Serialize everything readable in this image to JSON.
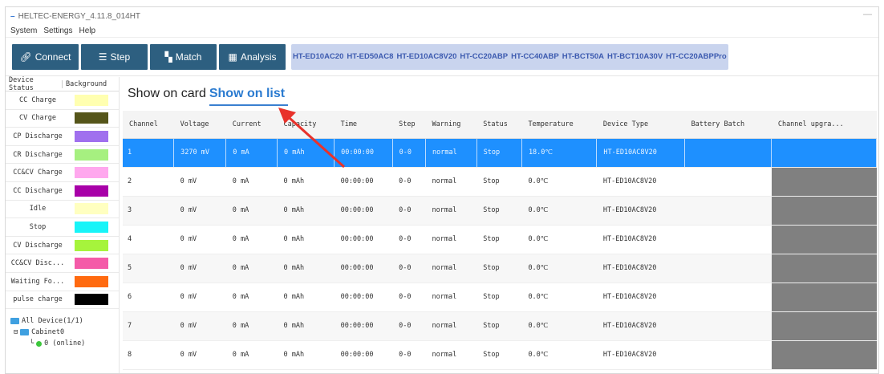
{
  "window": {
    "title": "HELTEC-ENERGY_4.11.8_014HT",
    "minimize": "—"
  },
  "menu": [
    "System",
    "Settings",
    "Help"
  ],
  "toolbar": {
    "buttons": [
      {
        "label": "Connect",
        "icon": "link-icon"
      },
      {
        "label": "Step",
        "icon": "list-icon"
      },
      {
        "label": "Match",
        "icon": "match-icon"
      },
      {
        "label": "Analysis",
        "icon": "chart-icon"
      }
    ],
    "device_tabs": [
      "HT-ED10AC20",
      "HT-ED50AC8",
      "HT-ED10AC8V20",
      "HT-CC20ABP",
      "HT-CC40ABP",
      "HT-BCT50A",
      "HT-BCT10A30V",
      "HT-CC20ABPPro"
    ]
  },
  "legend": {
    "header_status": "Device Status",
    "header_bg": "Background",
    "items": [
      {
        "label": "CC Charge",
        "color": "#ffffb0"
      },
      {
        "label": "CV Charge",
        "color": "#55551a"
      },
      {
        "label": "CP Discharge",
        "color": "#a070ee"
      },
      {
        "label": "CR Discharge",
        "color": "#a6f080"
      },
      {
        "label": "CC&CV Charge",
        "color": "#ffa8ee"
      },
      {
        "label": "CC Discharge",
        "color": "#a800a8"
      },
      {
        "label": "Idle",
        "color": "#ffffc0"
      },
      {
        "label": "Stop",
        "color": "#18f4f8"
      },
      {
        "label": "CV Discharge",
        "color": "#a6f43c"
      },
      {
        "label": "CC&CV Disc...",
        "color": "#f45aa8"
      },
      {
        "label": "Waiting Fo...",
        "color": "#ff6a10"
      },
      {
        "label": "pulse charge",
        "color": "#000000"
      }
    ]
  },
  "tree": {
    "root": "All Device(1/1)",
    "cabinet": "Cabinet0",
    "node": "0 (online)"
  },
  "view": {
    "card": "Show on card",
    "list": "Show on list"
  },
  "table": {
    "columns": [
      "Channel",
      "Voltage",
      "Current",
      "Capacity",
      "Time",
      "Step",
      "Warning",
      "Status",
      "Temperature",
      "Device Type",
      "Battery Batch",
      "Channel upgra..."
    ],
    "rows": [
      [
        "1",
        "3270 mV",
        "0 mA",
        "0 mAh",
        "00:00:00",
        "0-0",
        "normal",
        "Stop",
        "18.0℃",
        "HT-ED10AC8V20",
        "",
        ""
      ],
      [
        "2",
        "0 mV",
        "0 mA",
        "0 mAh",
        "00:00:00",
        "0-0",
        "normal",
        "Stop",
        "0.0℃",
        "HT-ED10AC8V20",
        "",
        ""
      ],
      [
        "3",
        "0 mV",
        "0 mA",
        "0 mAh",
        "00:00:00",
        "0-0",
        "normal",
        "Stop",
        "0.0℃",
        "HT-ED10AC8V20",
        "",
        ""
      ],
      [
        "4",
        "0 mV",
        "0 mA",
        "0 mAh",
        "00:00:00",
        "0-0",
        "normal",
        "Stop",
        "0.0℃",
        "HT-ED10AC8V20",
        "",
        ""
      ],
      [
        "5",
        "0 mV",
        "0 mA",
        "0 mAh",
        "00:00:00",
        "0-0",
        "normal",
        "Stop",
        "0.0℃",
        "HT-ED10AC8V20",
        "",
        ""
      ],
      [
        "6",
        "0 mV",
        "0 mA",
        "0 mAh",
        "00:00:00",
        "0-0",
        "normal",
        "Stop",
        "0.0℃",
        "HT-ED10AC8V20",
        "",
        ""
      ],
      [
        "7",
        "0 mV",
        "0 mA",
        "0 mAh",
        "00:00:00",
        "0-0",
        "normal",
        "Stop",
        "0.0℃",
        "HT-ED10AC8V20",
        "",
        ""
      ],
      [
        "8",
        "0 mV",
        "0 mA",
        "0 mAh",
        "00:00:00",
        "0-0",
        "normal",
        "Stop",
        "0.0℃",
        "HT-ED10AC8V20",
        "",
        ""
      ]
    ],
    "selected_row": 0,
    "accent": "#1e90ff"
  }
}
